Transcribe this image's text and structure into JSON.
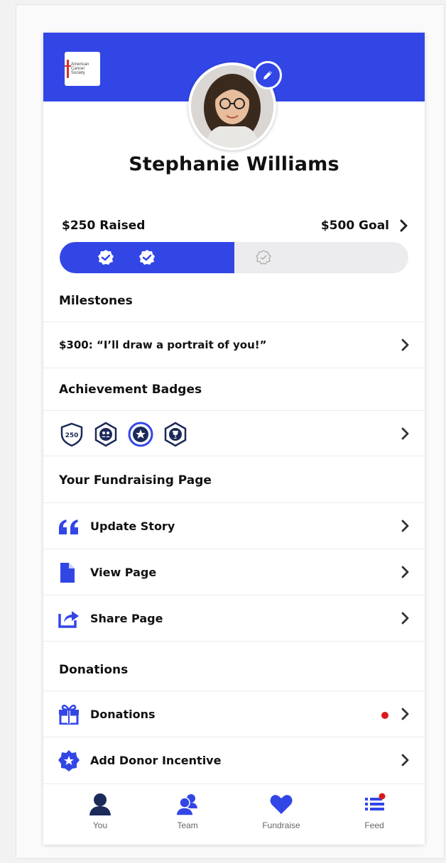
{
  "colors": {
    "accent": "#3246e6",
    "alert": "#d81b1b"
  },
  "header": {
    "logo_text": [
      "American",
      "Cancer",
      "Society"
    ]
  },
  "profile": {
    "name": "Stephanie Williams"
  },
  "progress": {
    "raised_label": "$250 Raised",
    "goal_label": "$500 Goal",
    "raised": 250,
    "goal": 500
  },
  "milestones": {
    "title": "Milestones",
    "item": "$300: “I’ll draw a portrait of you!”"
  },
  "badges": {
    "title": "Achievement Badges",
    "items": [
      {
        "icon": "shield-250-badge-icon",
        "text": "250"
      },
      {
        "icon": "team-hexagon-badge-icon"
      },
      {
        "icon": "star-circle-badge-icon"
      },
      {
        "icon": "trophy-badge-icon"
      }
    ]
  },
  "fundraising_page": {
    "title": "Your Fundraising Page",
    "items": [
      {
        "label": "Update Story",
        "icon": "quote-icon"
      },
      {
        "label": "View Page",
        "icon": "document-icon"
      },
      {
        "label": "Share Page",
        "icon": "share-icon"
      }
    ]
  },
  "donations": {
    "title": "Donations",
    "items": [
      {
        "label": "Donations",
        "icon": "gift-icon",
        "has_alert": true
      },
      {
        "label": "Add Donor Incentive",
        "icon": "star-badge-icon"
      }
    ]
  },
  "tabs": [
    {
      "label": "You",
      "icon": "person-icon",
      "active": true
    },
    {
      "label": "Team",
      "icon": "team-icon"
    },
    {
      "label": "Fundraise",
      "icon": "heart-icon"
    },
    {
      "label": "Feed",
      "icon": "list-icon",
      "has_alert": true
    }
  ]
}
